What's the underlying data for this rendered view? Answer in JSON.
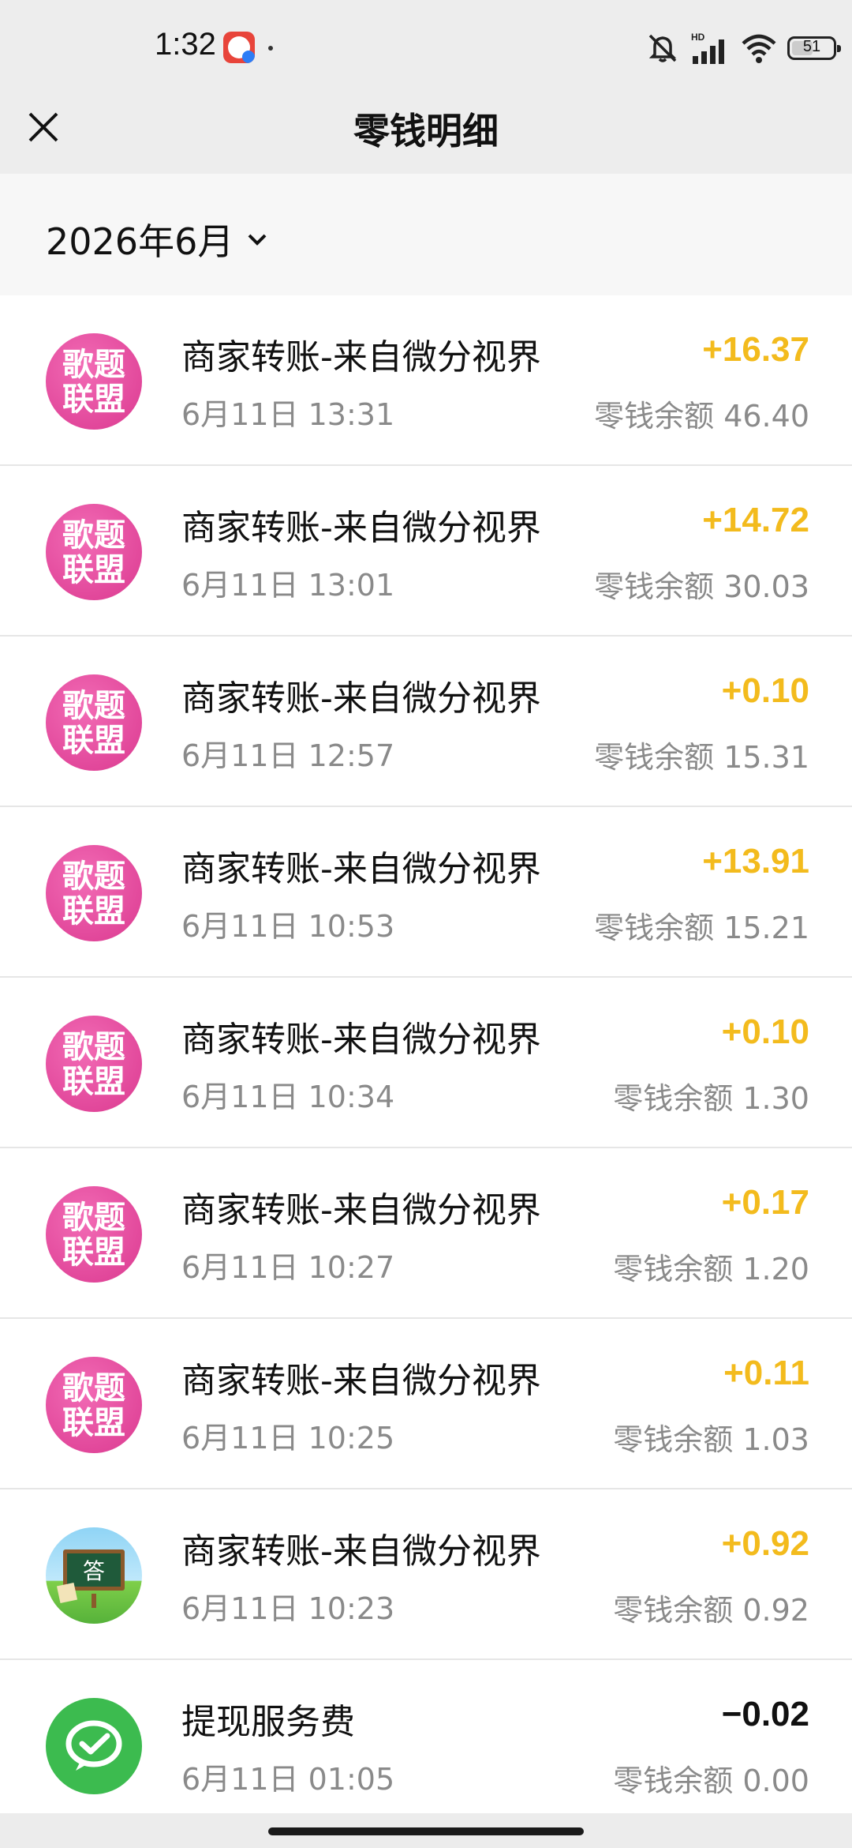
{
  "status_bar": {
    "time": "1:32",
    "battery": "51",
    "network": "HD"
  },
  "nav": {
    "title": "零钱明细"
  },
  "filter": {
    "month": "2026年6月"
  },
  "transactions": [
    {
      "title": "商家转账-来自微分视界",
      "time": "6月11日 13:31",
      "amount": "+16.37",
      "balance": "零钱余额 46.40",
      "avatar": "pink",
      "avatar_text": "歌题联盟"
    },
    {
      "title": "商家转账-来自微分视界",
      "time": "6月11日 13:01",
      "amount": "+14.72",
      "balance": "零钱余额 30.03",
      "avatar": "pink",
      "avatar_text": "歌题联盟"
    },
    {
      "title": "商家转账-来自微分视界",
      "time": "6月11日 12:57",
      "amount": "+0.10",
      "balance": "零钱余额 15.31",
      "avatar": "pink",
      "avatar_text": "歌题联盟"
    },
    {
      "title": "商家转账-来自微分视界",
      "time": "6月11日 10:53",
      "amount": "+13.91",
      "balance": "零钱余额 15.21",
      "avatar": "pink",
      "avatar_text": "歌题联盟"
    },
    {
      "title": "商家转账-来自微分视界",
      "time": "6月11日 10:34",
      "amount": "+0.10",
      "balance": "零钱余额 1.30",
      "avatar": "pink",
      "avatar_text": "歌题联盟"
    },
    {
      "title": "商家转账-来自微分视界",
      "time": "6月11日 10:27",
      "amount": "+0.17",
      "balance": "零钱余额 1.20",
      "avatar": "pink",
      "avatar_text": "歌题联盟"
    },
    {
      "title": "商家转账-来自微分视界",
      "time": "6月11日 10:25",
      "amount": "+0.11",
      "balance": "零钱余额 1.03",
      "avatar": "pink",
      "avatar_text": "歌题联盟"
    },
    {
      "title": "商家转账-来自微分视界",
      "time": "6月11日 10:23",
      "amount": "+0.92",
      "balance": "零钱余额 0.92",
      "avatar": "board",
      "avatar_text": "答"
    },
    {
      "title": "提现服务费",
      "time": "6月11日 01:05",
      "amount": "−0.02",
      "balance": "零钱余额 0.00",
      "avatar": "wechat",
      "avatar_text": ""
    }
  ],
  "colors": {
    "income": "#f3bb1d",
    "expense": "#111111",
    "avatar_pink": "#e2489b",
    "wechat_green": "#3cbb4f"
  }
}
